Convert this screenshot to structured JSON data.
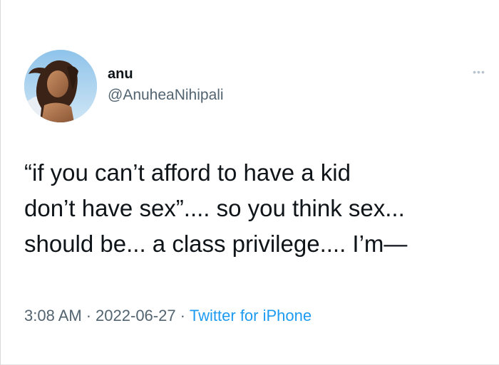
{
  "tweet": {
    "author": {
      "display_name": "anu",
      "handle": "@AnuheaNihipali",
      "avatar_icon": "profile-photo"
    },
    "more_icon": "more-options-icon",
    "more_glyph": "•••",
    "text_lines": [
      "“if you can’t afford to have a kid",
      "don’t have sex”.... so you think sex...",
      "should be... a class privilege.... I’m—"
    ],
    "meta": {
      "time": "3:08 AM",
      "separator": "·",
      "date": "2022-06-27",
      "source": "Twitter for iPhone"
    }
  },
  "colors": {
    "text_primary": "#0f1419",
    "text_secondary": "#536471",
    "link": "#1d9bf0",
    "background": "#ffffff"
  }
}
